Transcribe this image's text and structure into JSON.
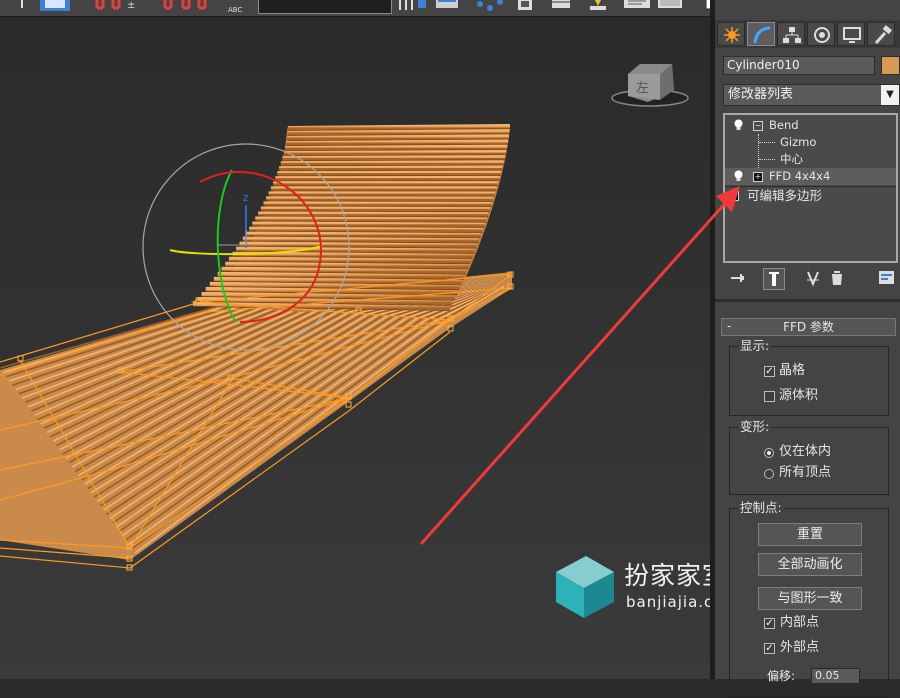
{
  "toolbar": {
    "abc_label": "ABC"
  },
  "panel": {
    "tabs": [
      {
        "name": "create",
        "icon": "sun-icon"
      },
      {
        "name": "modify",
        "icon": "curve-icon"
      },
      {
        "name": "hierarchy",
        "icon": "hierarchy-icon"
      },
      {
        "name": "motion",
        "icon": "motion-icon"
      },
      {
        "name": "display",
        "icon": "monitor-icon"
      },
      {
        "name": "utilities",
        "icon": "hammer-icon"
      }
    ],
    "object_name": "Cylinder010",
    "object_color": "#d69a55",
    "modifier_list": "修改器列表",
    "stack": {
      "bend": "Bend",
      "gizmo": "Gizmo",
      "center": "中心",
      "ffd": "FFD 4x4x4",
      "editable_poly": "可编辑多边形"
    },
    "rollout_title": "FFD 参数",
    "display_group": {
      "label": "显示:",
      "lattice": "晶格",
      "source_volume": "源体积",
      "lattice_checked": true,
      "source_volume_checked": false
    },
    "deform_group": {
      "label": "变形:",
      "only_in_volume": "仅在体内",
      "all_vertices": "所有顶点",
      "selected": "only_in_volume"
    },
    "control_points_group": {
      "label": "控制点:",
      "reset": "重置",
      "animate_all": "全部动画化",
      "conform_to_shape": "与图形一致",
      "inside_points": "内部点",
      "outside_points": "外部点",
      "inside_checked": true,
      "outside_checked": true,
      "offset_label": "偏移:",
      "offset_value": "0.05"
    }
  },
  "viewcube": {
    "face_label": "左"
  },
  "gizmo_axis_label": "Z",
  "watermark": {
    "title": "扮家家室内设计",
    "url": "banjiajia.com"
  },
  "colors": {
    "wood": "#d8954f",
    "lattice": "#ff9a1f",
    "arrow": "#f03a3a"
  }
}
